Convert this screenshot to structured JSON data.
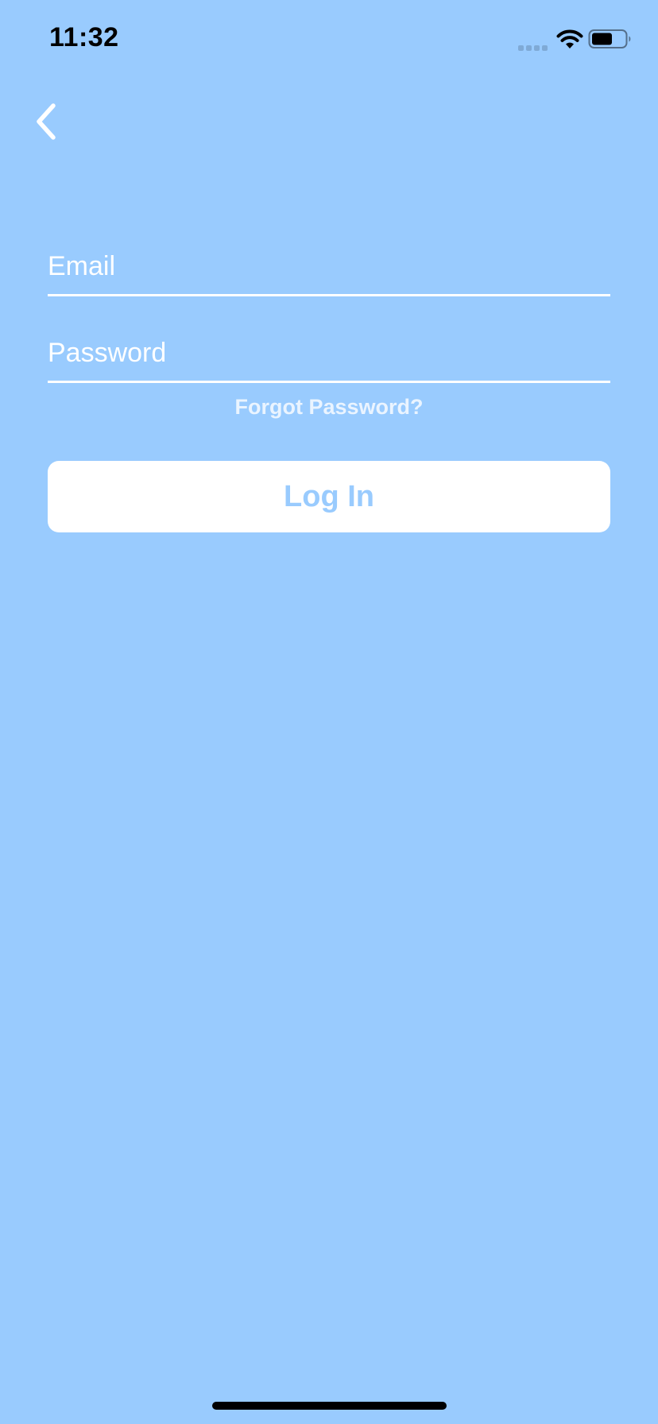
{
  "status_bar": {
    "time": "11:32"
  },
  "icons": {
    "back": "chevron-left-icon",
    "signal": "cellular-signal-icon",
    "wifi": "wifi-icon",
    "battery": "battery-icon"
  },
  "form": {
    "email_placeholder": "Email",
    "email_value": "",
    "password_placeholder": "Password",
    "password_value": ""
  },
  "forgot_password_label": "Forgot Password?",
  "login_label": "Log In",
  "colors": {
    "background": "#99cbfe",
    "button_background": "#ffffff",
    "button_text": "#99cbfe",
    "field_underline": "#ffffff",
    "forgot_text": "#eaf4ff"
  }
}
